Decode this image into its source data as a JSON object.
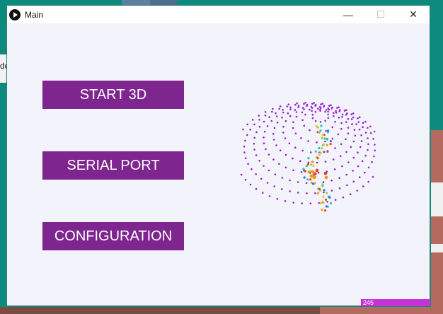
{
  "background": {
    "left_fragment_text": "de"
  },
  "window": {
    "title": "Main",
    "controls": {
      "minimize": "—",
      "maximize": "☐",
      "close": "✕"
    }
  },
  "menu": {
    "start_3d_label": "START 3D",
    "serial_port_label": "SERIAL PORT",
    "configuration_label": "CONFIGURATION",
    "button_color": "#7f2590"
  },
  "visualization": {
    "name": "point-cloud-sphere",
    "point_color": "#9b1ed1"
  },
  "status": {
    "counter_value": "245",
    "counter_color": "#c533d8"
  }
}
